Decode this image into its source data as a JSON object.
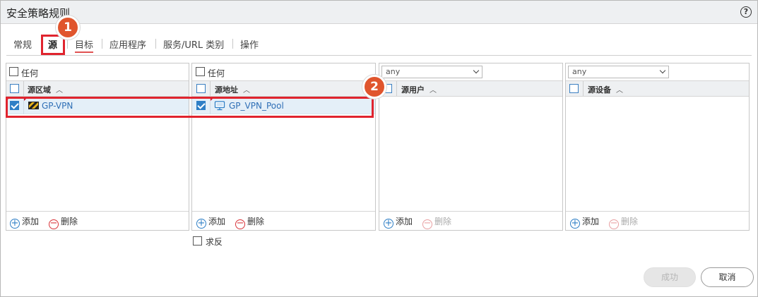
{
  "dialog": {
    "title": "安全策略规则"
  },
  "tabs": [
    {
      "label": "常规"
    },
    {
      "label": "源"
    },
    {
      "label": "目标"
    },
    {
      "label": "应用程序"
    },
    {
      "label": "服务/URL 类别"
    },
    {
      "label": "操作"
    }
  ],
  "badges": {
    "one": "1",
    "two": "2"
  },
  "panels": {
    "zone": {
      "any_label": "任何",
      "column": "源区域",
      "rows": [
        {
          "name": "GP-VPN",
          "checked": true
        }
      ],
      "add": "添加",
      "delete": "删除"
    },
    "address": {
      "any_label": "任何",
      "column": "源地址",
      "rows": [
        {
          "name": "GP_VPN_Pool",
          "checked": true
        }
      ],
      "add": "添加",
      "delete": "删除",
      "negate": "求反"
    },
    "user": {
      "dropdown": "any",
      "column": "源用户",
      "add": "添加",
      "delete": "删除"
    },
    "device": {
      "dropdown": "any",
      "column": "源设备",
      "add": "添加",
      "delete": "删除"
    }
  },
  "buttons": {
    "ok": "成功",
    "cancel": "取消"
  },
  "colors": {
    "accent": "#2f7fc6",
    "highlight": "#e0242e",
    "badge": "#e0552d"
  }
}
